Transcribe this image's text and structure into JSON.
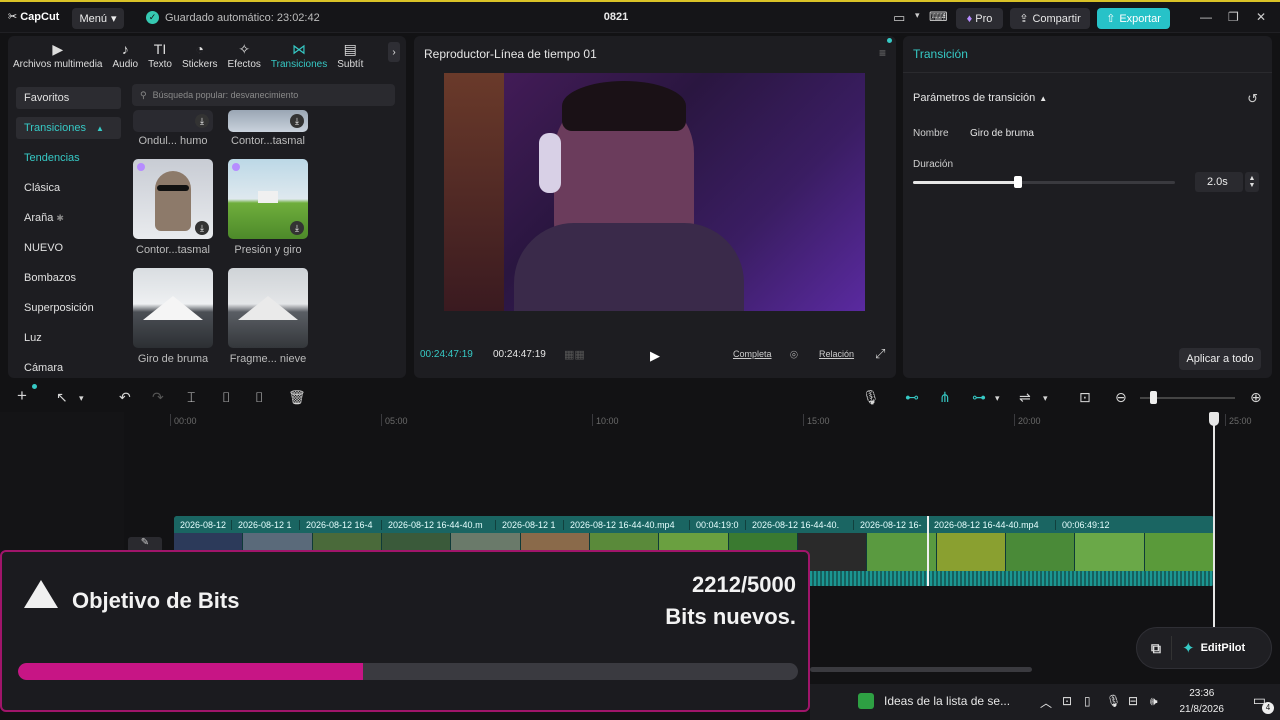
{
  "titlebar": {
    "logo": "CapCut",
    "menu": "Menú",
    "autosave": "Guardado automático: 23:02:42",
    "project": "0821",
    "pro": "Pro",
    "share": "Compartir",
    "export": "Exportar"
  },
  "media": {
    "tabs": [
      {
        "icon": "media-icon",
        "label": "Archivos multimedia"
      },
      {
        "icon": "audio-icon",
        "label": "Audio"
      },
      {
        "icon": "text-icon",
        "label": "Texto"
      },
      {
        "icon": "sticker-icon",
        "label": "Stickers"
      },
      {
        "icon": "effects-icon",
        "label": "Efectos"
      },
      {
        "icon": "transition-icon",
        "label": "Transiciones"
      },
      {
        "icon": "subtitle-icon",
        "label": "Subtít"
      }
    ],
    "search_placeholder": "Búsqueda popular: desvanecimiento",
    "categories": [
      "Favoritos",
      "Transiciones",
      "Tendencias",
      "Clásica",
      "Araña",
      "NUEVO",
      "Bombazos",
      "Superposición",
      "Luz",
      "Cámara"
    ],
    "thumbs": [
      "Ondul... humo",
      "Contor...tasmal",
      "Contor...tasmal",
      "Presión y giro",
      "Giro de bruma",
      "Fragme... nieve"
    ]
  },
  "player": {
    "title": "Reproductor-Línea de tiempo 01",
    "current_time": "00:24:47:19",
    "total_time": "00:24:47:19",
    "full": "Completa",
    "ratio": "Relación"
  },
  "props": {
    "title": "Transición",
    "section": "Parámetros de transición",
    "name_label": "Nombre",
    "name_value": "Giro de bruma",
    "duration_label": "Duración",
    "duration_value": "2.0s",
    "duration_fraction": 0.4,
    "apply": "Aplicar a todo"
  },
  "timeline": {
    "ruler": [
      "00:00",
      "05:00",
      "10:00",
      "15:00",
      "20:00",
      "25:00"
    ],
    "clips": [
      "2026-08-12",
      "2026-08-12 1",
      "2026-08-12 16-4",
      "2026-08-12 16-44-40.m",
      "2026-08-12 1",
      "2026-08-12 16-44-40.mp4",
      "00:04:19:0",
      "2026-08-12 16-44-40.",
      "2026-08-12 16-",
      "2026-08-12 16-44-40.mp4",
      "00:06:49:12"
    ]
  },
  "editpilot": "EditPilot",
  "bits": {
    "title": "Objetivo de Bits",
    "current": "2212",
    "goal": "/5000",
    "subtitle": "Bits nuevos.",
    "progress": 0.4424
  },
  "taskbar": {
    "notification": "Ideas de la lista de se...",
    "time": "23:36",
    "date": "21/8/2026",
    "badge": "4"
  },
  "colors": {
    "accent": "#36c9c5",
    "export": "#27c2c8",
    "bits": "#c71585",
    "border": "#a0156a"
  }
}
